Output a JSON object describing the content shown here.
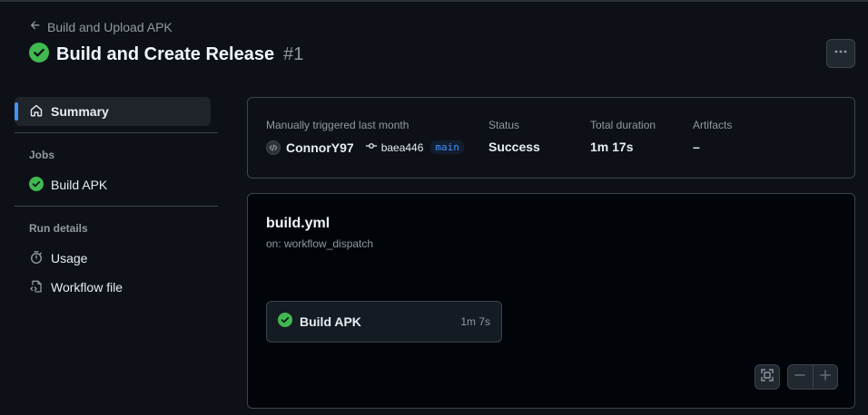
{
  "header": {
    "back_label": "Build and Upload APK",
    "run_title": "Build and Create Release",
    "run_number": "#1"
  },
  "sidebar": {
    "summary_label": "Summary",
    "jobs_heading": "Jobs",
    "jobs": [
      {
        "label": "Build APK",
        "status": "success"
      }
    ],
    "run_details_heading": "Run details",
    "usage_label": "Usage",
    "workflow_file_label": "Workflow file"
  },
  "summary": {
    "trigger_label": "Manually triggered last month",
    "actor": "ConnorY97",
    "commit": "baea446",
    "branch": "main",
    "status_label": "Status",
    "status_value": "Success",
    "duration_label": "Total duration",
    "duration_value": "1m 17s",
    "artifacts_label": "Artifacts",
    "artifacts_value": "–"
  },
  "workflow": {
    "file_name": "build.yml",
    "trigger": "on: workflow_dispatch",
    "job": {
      "name": "Build APK",
      "duration": "1m 7s",
      "status": "success"
    }
  },
  "colors": {
    "background": "#0d1117",
    "success": "#3fb950",
    "accent": "#4493f8",
    "border": "#3d444d",
    "muted_text": "#9198a1"
  },
  "icons": {
    "back": "arrow-left-icon",
    "status": "check-circle-fill-icon",
    "menu": "kebab-horizontal-icon",
    "summary": "home-icon",
    "usage": "stopwatch-icon",
    "workflow_file": "file-code-icon",
    "commit": "git-commit-icon",
    "fit": "screen-full-icon",
    "zoom_out": "minus-icon",
    "zoom_in": "plus-icon"
  }
}
